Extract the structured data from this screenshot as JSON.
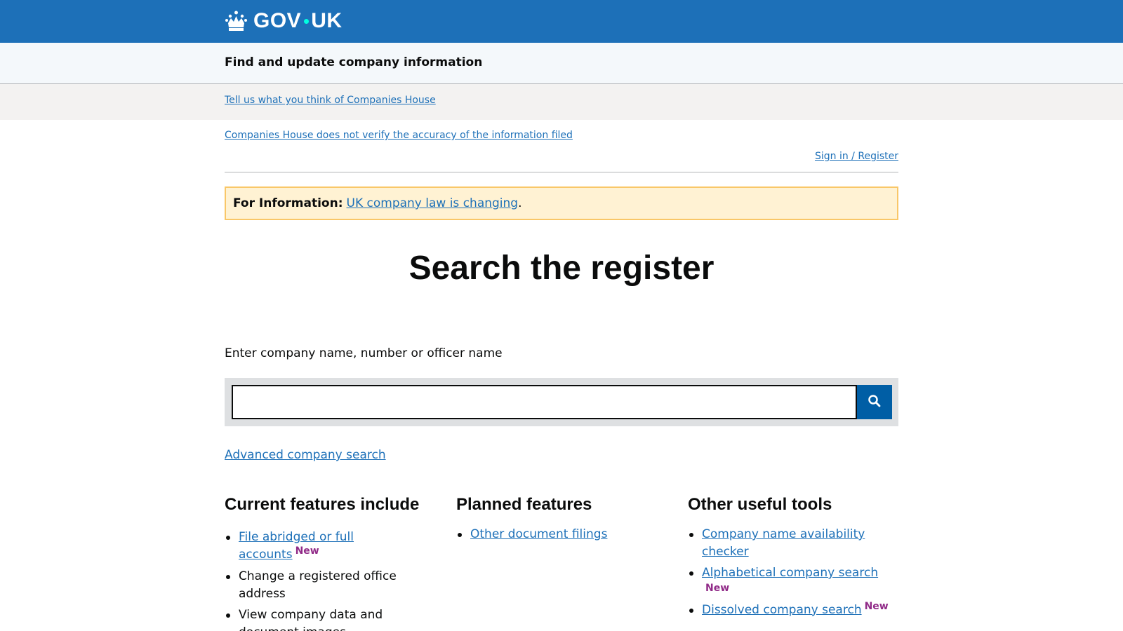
{
  "header": {
    "logo_text_left": "GOV",
    "logo_text_right": "UK",
    "logo_icon": "crown-icon"
  },
  "service": {
    "name": "Find and update company information"
  },
  "feedback": {
    "link": "Tell us what you think of Companies House"
  },
  "notices": {
    "verify_link": "Companies House does not verify the accuracy of the information filed",
    "signin_link": "Sign in / Register"
  },
  "banner": {
    "label": "For Information:",
    "link": "UK company law is changing",
    "suffix": "."
  },
  "main": {
    "title": "Search the register",
    "search_label": "Enter company name, number or officer name",
    "search_value": "",
    "search_icon": "search-icon",
    "advanced_link": "Advanced company search"
  },
  "columns": {
    "current": {
      "heading": "Current features include",
      "items": [
        {
          "text": "File abridged or full accounts",
          "link": true,
          "badge": "New"
        },
        {
          "text": "Change a registered office address",
          "link": false
        },
        {
          "text": "View company data and document images",
          "link": false
        }
      ]
    },
    "planned": {
      "heading": "Planned features",
      "items": [
        {
          "text": "Other document filings",
          "link": true
        }
      ]
    },
    "tools": {
      "heading": "Other useful tools",
      "items": [
        {
          "text": "Company name availability checker",
          "link": true
        },
        {
          "text": "Alphabetical company search",
          "link": true,
          "badge": "New"
        },
        {
          "text": "Dissolved company search",
          "link": true,
          "badge": "New"
        }
      ]
    }
  },
  "colors": {
    "header_blue": "#1d70b8",
    "link_blue": "#1d70b8",
    "button_blue": "#005ea5",
    "badge_purple": "#912b88",
    "banner_bg": "#fff2d3",
    "banner_border": "#f9c768"
  }
}
